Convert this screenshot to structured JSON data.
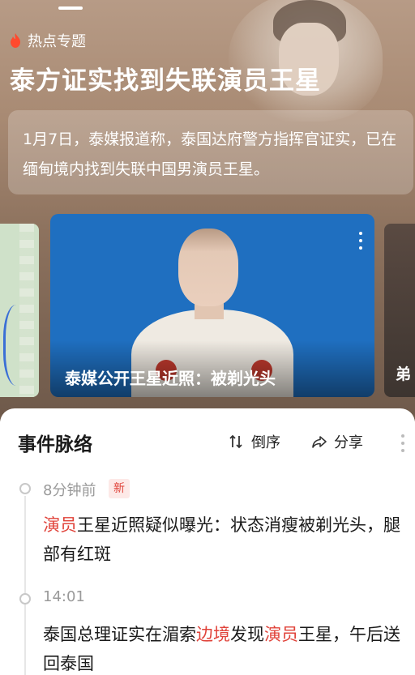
{
  "hero": {
    "topic_label": "热点专题",
    "headline": "泰方证实找到失联演员王星",
    "summary": "1月7日，泰媒报道称，泰国达府警方指挥官证实，已在缅甸境内找到失联中国男演员王星。"
  },
  "cards": {
    "main_caption": "泰媒公开王星近照：被剃光头",
    "right_caption": "弟"
  },
  "timeline": {
    "title": "事件脉络",
    "order_label": "倒序",
    "share_label": "分享",
    "items": [
      {
        "time": "8分钟前",
        "badge": "新",
        "text_hl_1": "演员",
        "text_rest_1": "王星近照疑似曝光：状态消瘦被剃光头，腿部有红斑"
      },
      {
        "time": "14:01",
        "text_a": "泰国总理证实在湄索",
        "text_hl_a": "边境",
        "text_b": "发现",
        "text_hl_b": "演员",
        "text_c": "王星，午后送回泰国"
      }
    ]
  },
  "colors": {
    "accent": "#e0433a",
    "hero_bg": "#a88a73",
    "card_bg": "#1f6fc0"
  },
  "icons": [
    "flame-icon",
    "sort-icon",
    "share-icon",
    "more-icon"
  ]
}
